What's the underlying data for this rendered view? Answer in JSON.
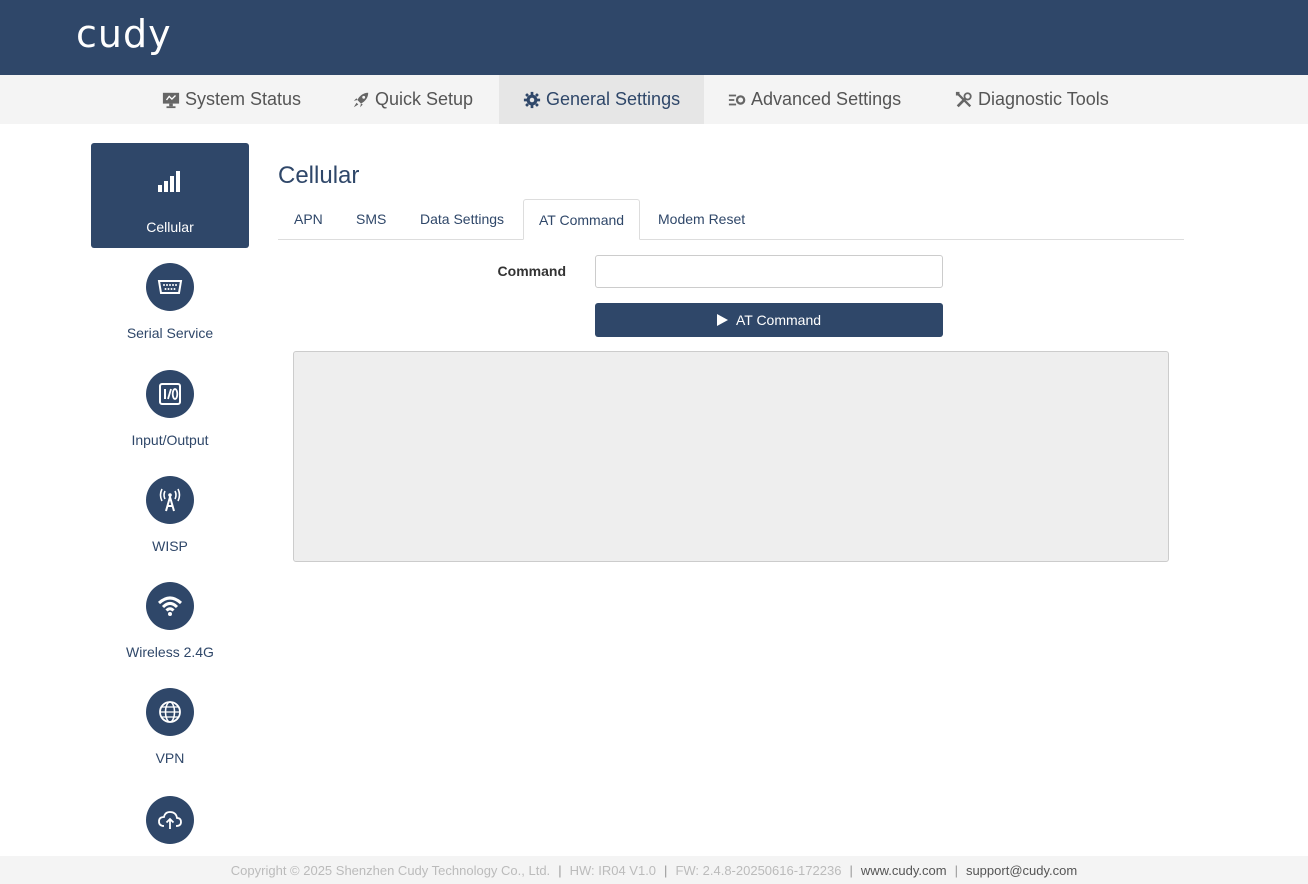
{
  "brand": {
    "logo": "cudy",
    "header_color": "#2f4769"
  },
  "topnav": [
    {
      "label": "System Status",
      "icon": "monitor-icon"
    },
    {
      "label": "Quick Setup",
      "icon": "rocket-icon"
    },
    {
      "label": "General Settings",
      "icon": "gear-icon",
      "active": true
    },
    {
      "label": "Advanced Settings",
      "icon": "sliders-gear-icon"
    },
    {
      "label": "Diagnostic Tools",
      "icon": "tools-icon"
    }
  ],
  "sidebar": [
    {
      "label": "Cellular",
      "icon": "signal-bars-icon",
      "active": true
    },
    {
      "label": "Serial Service",
      "icon": "serial-port-icon"
    },
    {
      "label": "Input/Output",
      "icon": "io-icon"
    },
    {
      "label": "WISP",
      "icon": "antenna-icon"
    },
    {
      "label": "Wireless 2.4G",
      "icon": "wifi-icon"
    },
    {
      "label": "VPN",
      "icon": "globe-icon"
    },
    {
      "label": "",
      "icon": "cloud-upload-icon"
    }
  ],
  "page": {
    "title": "Cellular",
    "tabs": [
      {
        "label": "APN"
      },
      {
        "label": "SMS"
      },
      {
        "label": "Data Settings"
      },
      {
        "label": "AT Command",
        "active": true
      },
      {
        "label": "Modem Reset"
      }
    ],
    "command_label": "Command",
    "command_value": "",
    "button_label": "AT Command",
    "output": ""
  },
  "footer": {
    "copyright": "Copyright © 2025 Shenzhen Cudy Technology Co., Ltd.",
    "hw": "HW: IR04 V1.0",
    "fw": "FW: 2.4.8-20250616-172236",
    "website": "www.cudy.com",
    "email": "support@cudy.com"
  }
}
